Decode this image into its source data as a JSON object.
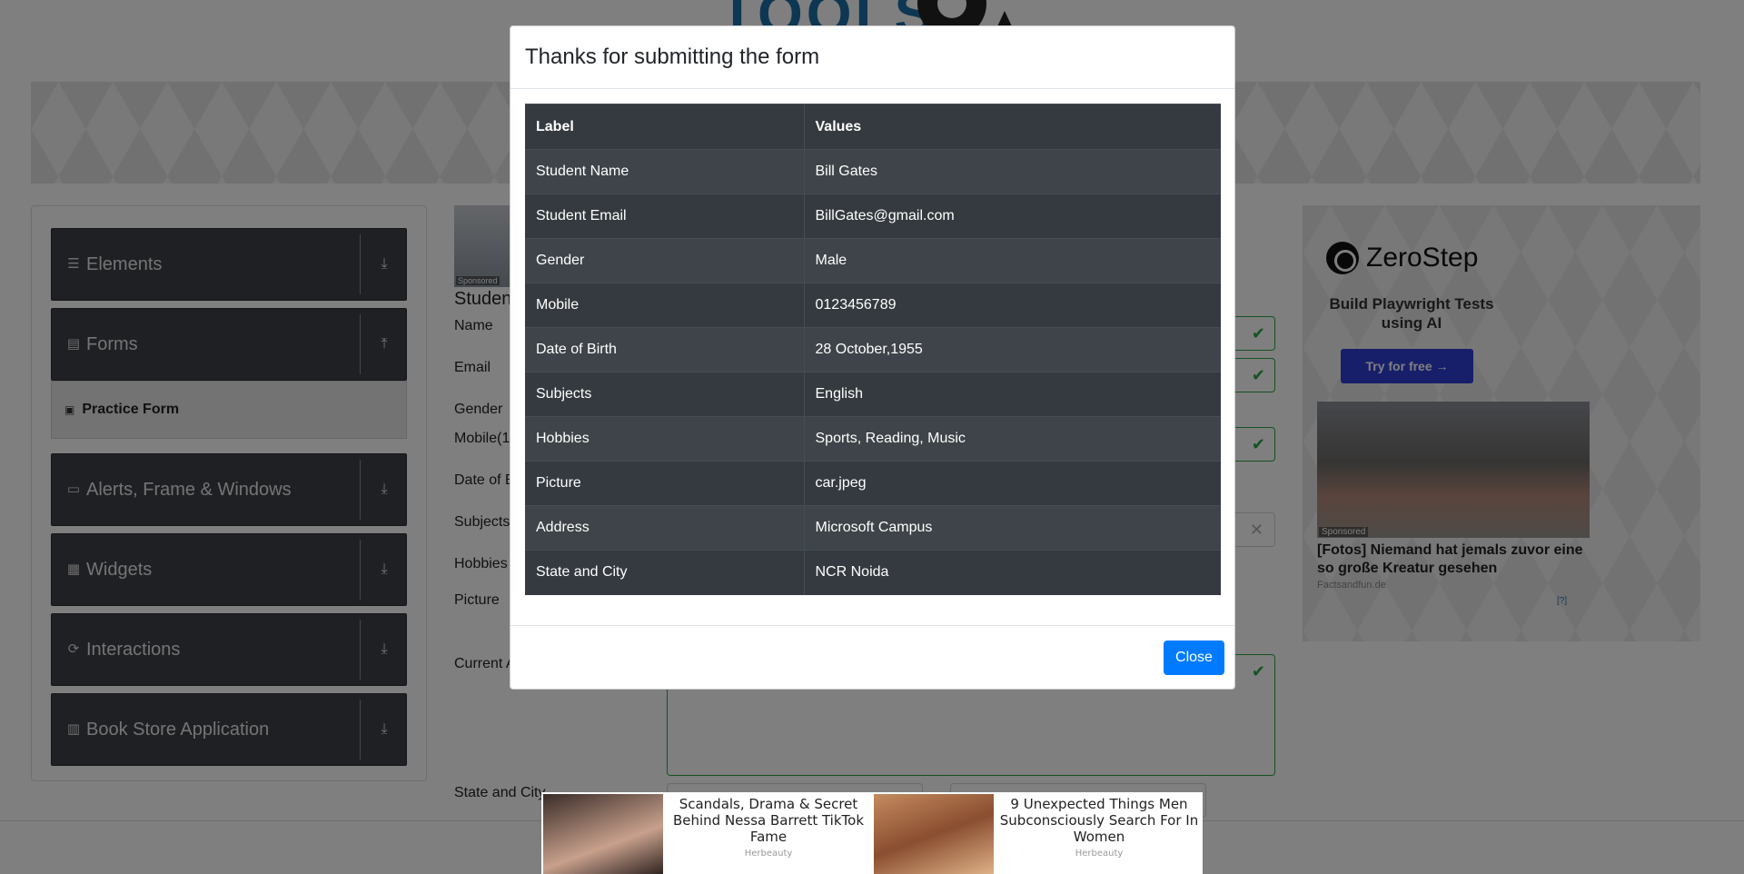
{
  "background_page": {
    "sidebar": {
      "groups": [
        {
          "label": "Elements",
          "icon": "menu-icon",
          "arrow": "download-icon"
        },
        {
          "label": "Forms",
          "icon": "document-icon",
          "arrow": "upload-icon"
        },
        {
          "label": "Alerts, Frame & Windows",
          "icon": "window-icon",
          "arrow": "download-icon"
        },
        {
          "label": "Widgets",
          "icon": "grid-icon",
          "arrow": "download-icon"
        },
        {
          "label": "Interactions",
          "icon": "interaction-icon",
          "arrow": "download-icon"
        },
        {
          "label": "Book Store Application",
          "icon": "books-icon",
          "arrow": "download-icon"
        }
      ],
      "active_item": "Practice Form"
    },
    "form": {
      "title_partial": "Studen",
      "thumb_sponsored": "Sponsored",
      "labels": {
        "name": "Name",
        "email": "Email",
        "gender": "Gender",
        "mobile": "Mobile(1",
        "dob": "Date of B",
        "subjects": "Subjects",
        "hobbies": "Hobbies",
        "picture": "Picture",
        "address": "Current A",
        "state_city": "State and City"
      }
    },
    "side_ad": {
      "brand": "ZeroStep",
      "tagline": "Build Playwright Tests using AI",
      "button": "Try for free →",
      "photo_sponsored": "Sponsored",
      "headline": "[Fotos] Niemand hat jemals zuvor eine so große Kreatur gesehen",
      "source": "Factsandfun.de",
      "adchoices": "[?]"
    },
    "bottom_ads": [
      {
        "title": "Scandals, Drama & Secret Behind Nessa Barrett TikTok Fame",
        "source": "Herbeauty"
      },
      {
        "title": "9 Unexpected Things Men Subconsciously Search For In Women",
        "source": "Herbeauty"
      }
    ]
  },
  "modal": {
    "title": "Thanks for submitting the form",
    "table": {
      "headers": [
        "Label",
        "Values"
      ],
      "rows": [
        [
          "Student Name",
          "Bill Gates"
        ],
        [
          "Student Email",
          "BillGates@gmail.com"
        ],
        [
          "Gender",
          "Male"
        ],
        [
          "Mobile",
          "0123456789"
        ],
        [
          "Date of Birth",
          "28 October,1955"
        ],
        [
          "Subjects",
          "English"
        ],
        [
          "Hobbies",
          "Sports, Reading, Music"
        ],
        [
          "Picture",
          "car.jpeg"
        ],
        [
          "Address",
          "Microsoft Campus"
        ],
        [
          "State and City",
          "NCR Noida"
        ]
      ]
    },
    "close_label": "Close"
  },
  "colors": {
    "primary_button": "#007bff",
    "table_dark": "#343a40",
    "valid_green": "#28a745",
    "sidebar_group": "#3f4148",
    "ad_button": "#2e3ed6"
  }
}
